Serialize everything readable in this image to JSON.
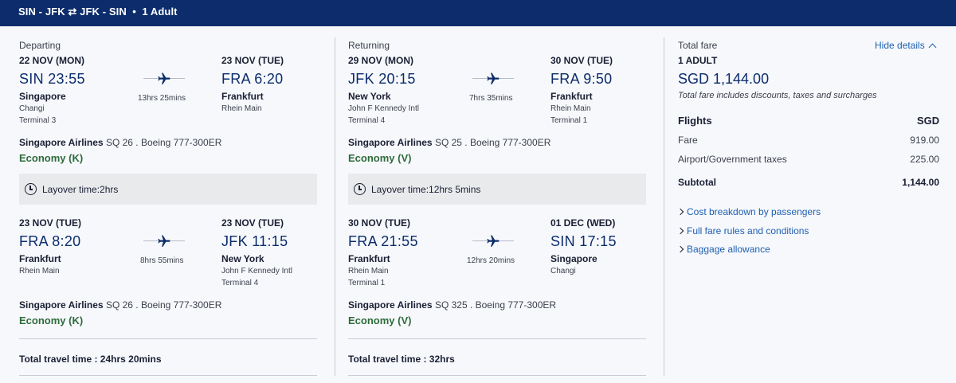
{
  "header": {
    "origin": "SIN - JFK",
    "swap": "⇄",
    "destination": "JFK - SIN",
    "bullet": "•",
    "passengers": "1 Adult"
  },
  "departing": {
    "heading": "Departing",
    "segments": [
      {
        "dep_date": "22 NOV (MON)",
        "dep_time": "SIN 23:55",
        "dep_city": "Singapore",
        "dep_airport": "Changi",
        "dep_terminal": "Terminal 3",
        "duration": "13hrs 25mins",
        "arr_date": "23 NOV (TUE)",
        "arr_time": "FRA 6:20",
        "arr_city": "Frankfurt",
        "arr_airport": "Rhein Main",
        "arr_terminal": "",
        "airline": "Singapore Airlines",
        "flight": "SQ 26 . Boeing 777-300ER",
        "cabin": "Economy (K)"
      },
      {
        "dep_date": "23 NOV (TUE)",
        "dep_time": "FRA 8:20",
        "dep_city": "Frankfurt",
        "dep_airport": "Rhein Main",
        "dep_terminal": "",
        "duration": "8hrs 55mins",
        "arr_date": "23 NOV (TUE)",
        "arr_time": "JFK 11:15",
        "arr_city": "New York",
        "arr_airport": "John F Kennedy Intl",
        "arr_terminal": "Terminal 4",
        "airline": "Singapore Airlines",
        "flight": "SQ 26 . Boeing 777-300ER",
        "cabin": "Economy (K)"
      }
    ],
    "layover": "Layover time:2hrs",
    "total_travel": "Total travel time : 24hrs 20mins"
  },
  "returning": {
    "heading": "Returning",
    "segments": [
      {
        "dep_date": "29 NOV (MON)",
        "dep_time": "JFK 20:15",
        "dep_city": "New York",
        "dep_airport": "John F Kennedy Intl",
        "dep_terminal": "Terminal 4",
        "duration": "7hrs 35mins",
        "arr_date": "30 NOV (TUE)",
        "arr_time": "FRA 9:50",
        "arr_city": "Frankfurt",
        "arr_airport": "Rhein Main",
        "arr_terminal": "Terminal 1",
        "airline": "Singapore Airlines",
        "flight": "SQ 25 . Boeing 777-300ER",
        "cabin": "Economy (V)"
      },
      {
        "dep_date": "30 NOV (TUE)",
        "dep_time": "FRA 21:55",
        "dep_city": "Frankfurt",
        "dep_airport": "Rhein Main",
        "dep_terminal": "Terminal 1",
        "duration": "12hrs 20mins",
        "arr_date": "01 DEC (WED)",
        "arr_time": "SIN 17:15",
        "arr_city": "Singapore",
        "arr_airport": "Changi",
        "arr_terminal": "",
        "airline": "Singapore Airlines",
        "flight": "SQ 325 . Boeing 777-300ER",
        "cabin": "Economy (V)"
      }
    ],
    "layover": "Layover time:12hrs 5mins",
    "total_travel": "Total travel time : 32hrs"
  },
  "fare": {
    "title": "Total fare",
    "hide_details": "Hide details",
    "passengers": "1 ADULT",
    "amount": "SGD 1,144.00",
    "note": "Total fare includes discounts, taxes and surcharges",
    "flights_label": "Flights",
    "currency": "SGD",
    "rows": [
      {
        "label": "Fare",
        "value": "919.00"
      },
      {
        "label": "Airport/Government taxes",
        "value": "225.00"
      }
    ],
    "subtotal_label": "Subtotal",
    "subtotal_value": "1,144.00",
    "links": [
      "Cost breakdown by passengers",
      "Full fare rules and conditions",
      "Baggage allowance"
    ]
  },
  "colors": {
    "header_bg": "#0c2c6b",
    "time_blue": "#0c2c6b",
    "cabin_green": "#2f6b3a",
    "link_blue": "#1f5fb0"
  }
}
